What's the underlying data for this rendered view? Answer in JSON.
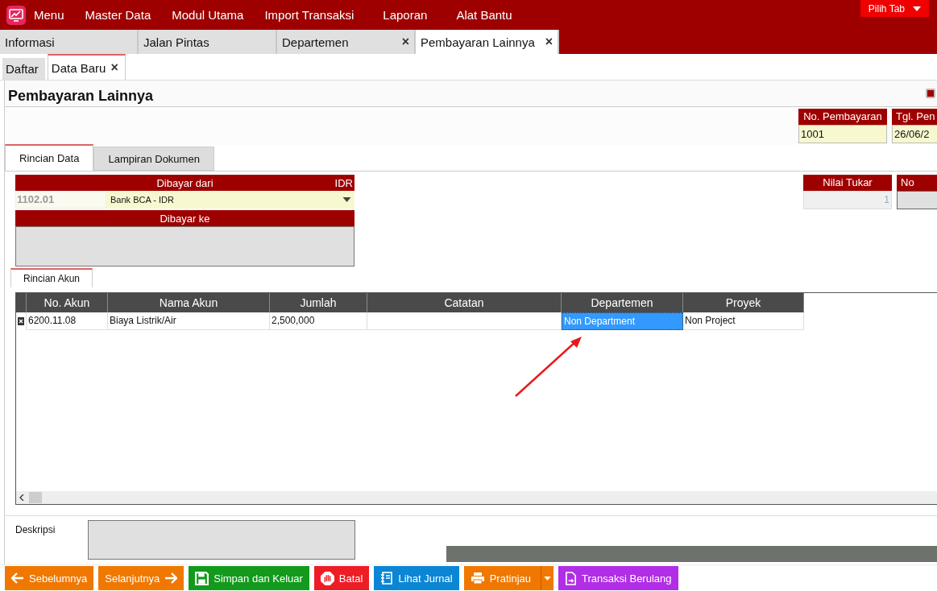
{
  "menu": {
    "items": [
      "Menu",
      "Master Data",
      "Modul Utama",
      "Import Transaksi",
      "Laporan",
      "Alat Bantu"
    ],
    "pick_tab": "Pilih Tab"
  },
  "tabs": [
    {
      "label": "Informasi",
      "selected": false
    },
    {
      "label": "Jalan Pintas",
      "selected": false
    },
    {
      "label": "Departemen",
      "selected": false,
      "close": "×"
    },
    {
      "label": "Pembayaran Lainnya",
      "selected": true,
      "close": "×"
    }
  ],
  "subtabs": [
    {
      "label": "Daftar",
      "selected": false
    },
    {
      "label": "Data Baru",
      "selected": true,
      "close": "×"
    }
  ],
  "form": {
    "title": "Pembayaran Lainnya",
    "header_fields": [
      {
        "label": "No. Pembayaran",
        "value": "1001"
      },
      {
        "label": "Tgl. Pen",
        "value": "26/06/2"
      }
    ],
    "detail_tabs": [
      {
        "label": "Rincian Data",
        "selected": true
      },
      {
        "label": "Lampiran Dokumen",
        "selected": false
      }
    ],
    "paid_from": {
      "label": "Dibayar dari",
      "currency": "IDR",
      "account_code": "1102.01",
      "account_name": "Bank BCA - IDR"
    },
    "paid_to": {
      "label": "Dibayar ke"
    },
    "side_fields": [
      {
        "label": "Nilai Tukar",
        "value": "1"
      },
      {
        "label": "No"
      }
    ],
    "grid_tabs": [
      {
        "label": "Rincian Akun",
        "selected": true
      }
    ],
    "grid": {
      "columns": [
        "No. Akun",
        "Nama Akun",
        "Jumlah",
        "Catatan",
        "Departemen",
        "Proyek"
      ],
      "rows": [
        {
          "cells": [
            {
              "text": "6200.11.08",
              "selected": false
            },
            {
              "text": "Biaya Listrik/Air",
              "selected": false
            },
            {
              "text": "2,500,000",
              "selected": false
            },
            {
              "selected": false
            },
            {
              "text": "Non Department",
              "selected": true
            },
            {
              "text": "Non Project",
              "selected": false
            }
          ]
        }
      ]
    },
    "description": {
      "label": "Deskripsi"
    }
  },
  "buttons": [
    {
      "label": "Sebelumnya",
      "color": "#f07800",
      "split": false
    },
    {
      "label": "Selanjutnya",
      "color": "#f07800",
      "split": false
    },
    {
      "label": "Simpan dan Keluar",
      "color": "#139a1c",
      "split": false
    },
    {
      "label": "Batal",
      "color": "#ee1c25",
      "split": false
    },
    {
      "label": "Lihat Jurnal",
      "color": "#0b86d4",
      "split": false
    },
    {
      "label": "Pratinjau",
      "color": "#f07800",
      "split": true
    },
    {
      "label": "Transaksi Berulang",
      "color": "#b12ee6",
      "split": false
    }
  ]
}
